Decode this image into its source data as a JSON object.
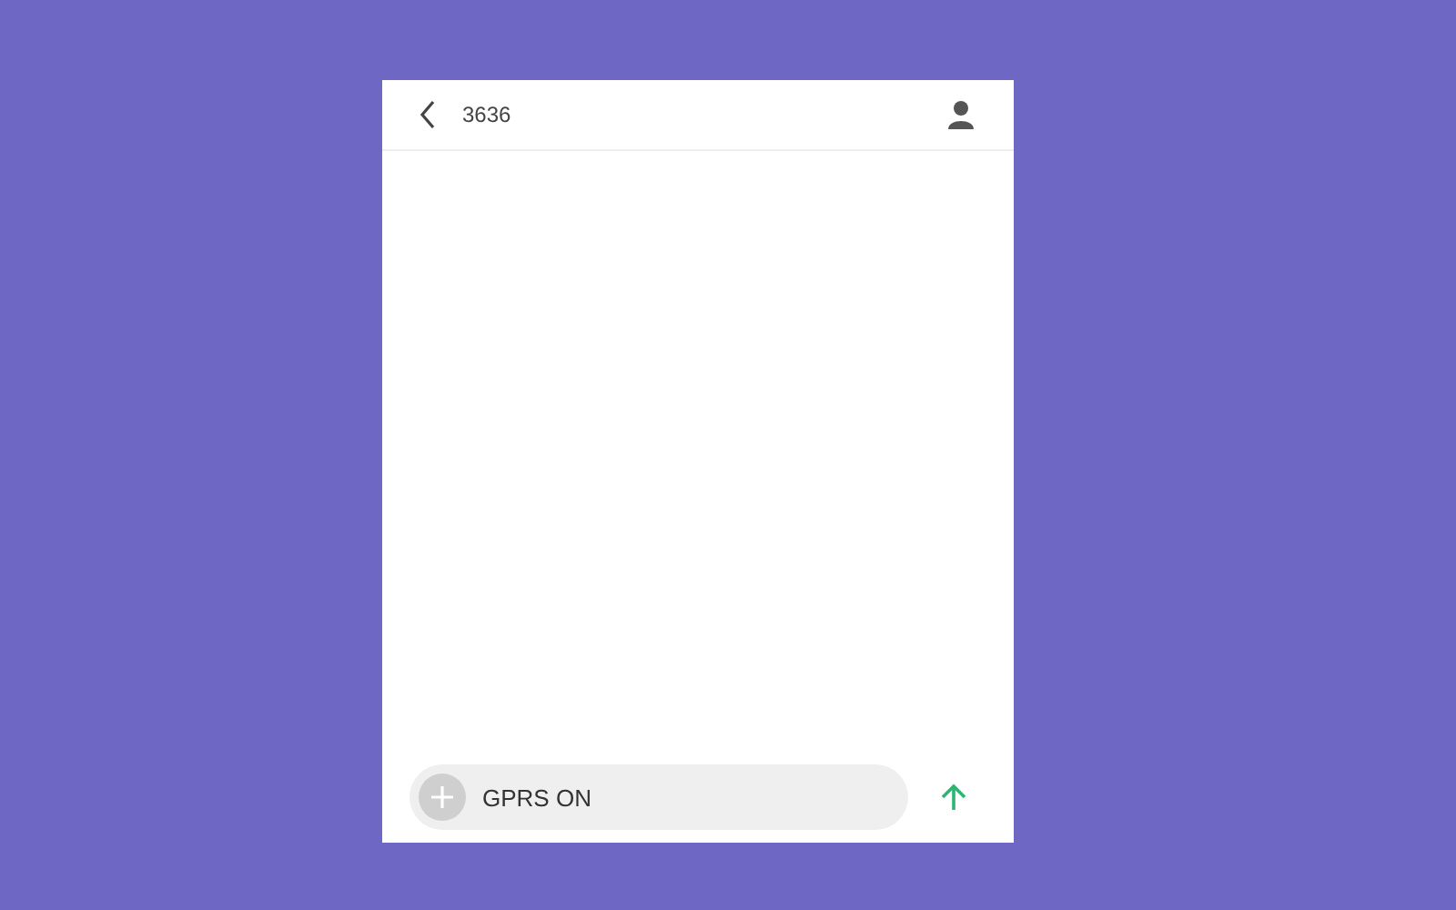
{
  "header": {
    "contact": "3636"
  },
  "composer": {
    "value": "GPRS ON"
  }
}
